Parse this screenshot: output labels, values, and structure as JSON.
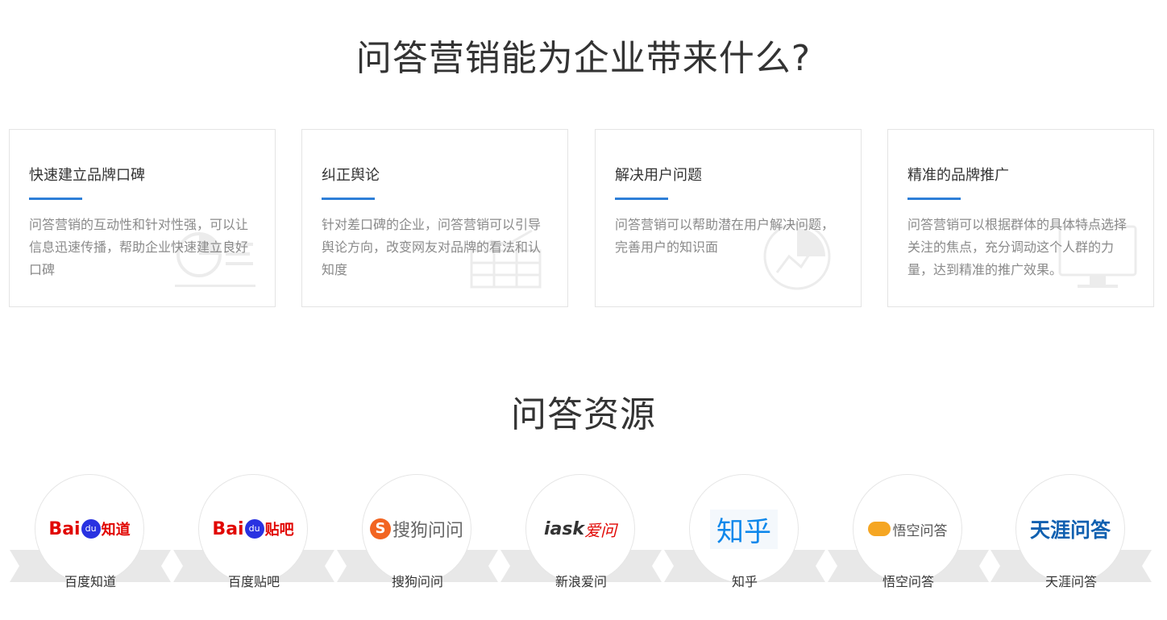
{
  "section1": {
    "title": "问答营销能为企业带来什么?",
    "cards": [
      {
        "title": "快速建立品牌口碑",
        "desc": "问答营销的互动性和针对性强，可以让信息迅速传播，帮助企业快速建立良好口碑"
      },
      {
        "title": "纠正舆论",
        "desc": "针对差口碑的企业，问答营销可以引导舆论方向，改变网友对品牌的看法和认知度"
      },
      {
        "title": "解决用户问题",
        "desc": "问答营销可以帮助潜在用户解决问题，完善用户的知识面"
      },
      {
        "title": "精准的品牌推广",
        "desc": "问答营销可以根据群体的具体特点选择关注的焦点，充分调动这个人群的力量，达到精准的推广效果。"
      }
    ]
  },
  "section2": {
    "title": "问答资源",
    "resources": [
      {
        "name": "百度知道",
        "logo_text": "Bai",
        "logo_text2": "知道",
        "icon": "baidu-zhidao-logo"
      },
      {
        "name": "百度贴吧",
        "logo_text": "Bai",
        "logo_text2": "贴吧",
        "icon": "baidu-tieba-logo"
      },
      {
        "name": "搜狗问问",
        "logo_text": "S",
        "logo_text2": "搜狗问问",
        "icon": "sogou-wenwen-logo"
      },
      {
        "name": "新浪爱问",
        "logo_text": "iask",
        "logo_text2": "爱问",
        "icon": "sina-iask-logo"
      },
      {
        "name": "知乎",
        "logo_text": "知乎",
        "icon": "zhihu-logo"
      },
      {
        "name": "悟空问答",
        "logo_text": "悟空问答",
        "icon": "wukong-wenda-logo"
      },
      {
        "name": "天涯问答",
        "logo_text": "天涯问答",
        "icon": "tianya-wenda-logo"
      }
    ]
  },
  "colors": {
    "accent": "#2e7fd8",
    "baidu_red": "#e10602",
    "baidu_blue": "#2932e1",
    "sogou_orange": "#f26522",
    "zhihu_blue": "#0f88eb",
    "tianya_blue": "#1060b0"
  }
}
